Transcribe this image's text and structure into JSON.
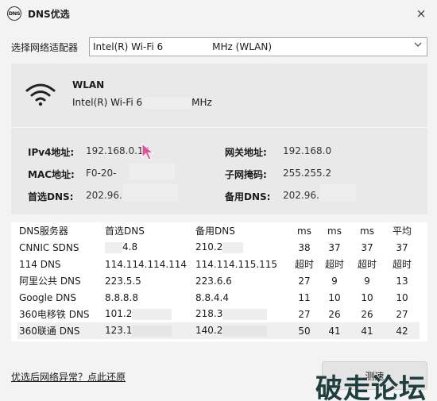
{
  "window": {
    "icon_text": "DNS",
    "title": "DNS优选",
    "close_icon": "×"
  },
  "adapter": {
    "label": "选择网络适配器",
    "selected_prefix": "Intel(R) Wi-Fi 6",
    "selected_suffix": "MHz  (WLAN)"
  },
  "network": {
    "name": "WLAN",
    "device_prefix": "Intel(R) Wi-Fi 6",
    "device_suffix": "MHz",
    "ipv4_label": "IPv4地址:",
    "ipv4_value": "192.168.0.10",
    "mac_label": "MAC地址:",
    "mac_value": "F0-20-",
    "primary_dns_label": "首选DNS:",
    "primary_dns_value": "202.96.",
    "gateway_label": "网关地址:",
    "gateway_value": "192.168.0",
    "subnet_label": "子网掩码:",
    "subnet_value": "255.255.2",
    "backup_dns_label": "备用DNS:",
    "backup_dns_value": "202.96."
  },
  "table": {
    "headers": [
      "DNS服务器",
      "首选DNS",
      "备用DNS",
      "ms",
      "ms",
      "ms",
      "平均"
    ],
    "rows": [
      [
        "CNNIC SDNS",
        "4.8",
        "210.2",
        "38",
        "37",
        "37",
        "37"
      ],
      [
        "114 DNS",
        "114.114.114.114",
        "114.114.115.115",
        "超时",
        "超时",
        "超时",
        "超时"
      ],
      [
        "阿里公共 DNS",
        "223.5.5",
        "223.6.6",
        "27",
        "9",
        "9",
        "13"
      ],
      [
        "Google DNS",
        "8.8.8.8",
        "8.8.4.4",
        "11",
        "10",
        "10",
        "10"
      ],
      [
        "360电移铁 DNS",
        "101.2",
        "218.3",
        "27",
        "26",
        "26",
        "27"
      ],
      [
        "360联通 DNS",
        "123.1",
        "140.2",
        "50",
        "41",
        "41",
        "42"
      ]
    ],
    "selected_row": 5
  },
  "footer": {
    "restore_link": "优选后网络异常？点此还原",
    "test_button": "测速",
    "brand_watermark": "破走论坛"
  },
  "colors": {
    "background": "#f3f3f3",
    "panel": "#e9e9e9",
    "cursor": "#e0559a"
  }
}
